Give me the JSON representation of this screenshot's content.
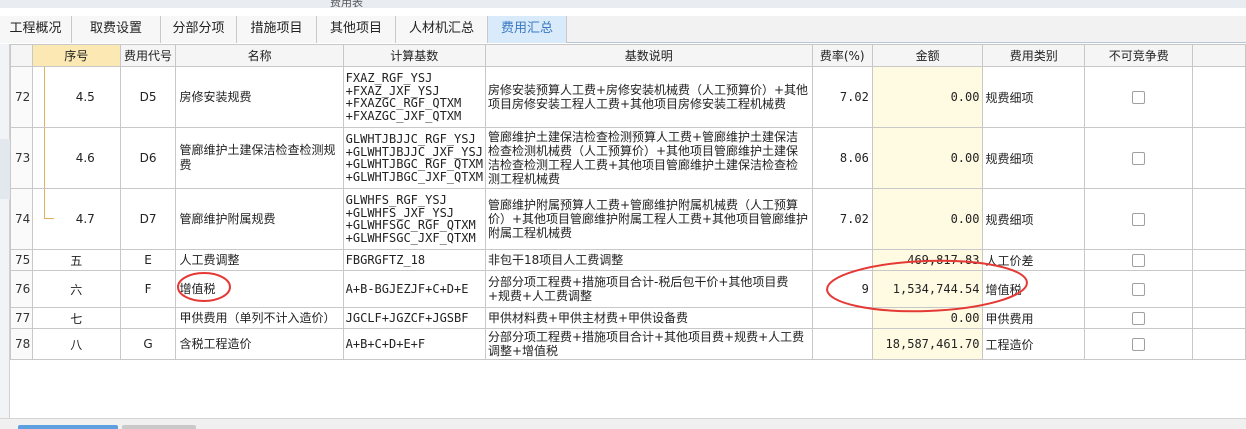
{
  "window_title": "费用表",
  "tabs": [
    {
      "label": "工程概况",
      "active": false
    },
    {
      "label": "取费设置",
      "active": false
    },
    {
      "label": "分部分项",
      "active": false
    },
    {
      "label": "措施项目",
      "active": false
    },
    {
      "label": "其他项目",
      "active": false
    },
    {
      "label": "人材机汇总",
      "active": false
    },
    {
      "label": "费用汇总",
      "active": true
    }
  ],
  "columns": {
    "seq": "序号",
    "code": "费用代号",
    "name": "名称",
    "base": "计算基数",
    "desc": "基数说明",
    "rate": "费率(%)",
    "amount": "金额",
    "category": "费用类别",
    "noncompete": "不可竞争费"
  },
  "rows": [
    {
      "no": "72",
      "seq": "4.5",
      "code": "D5",
      "name": "房修安装规费",
      "base": "FXAZ_RGF_YSJ\n+FXAZ_JXF_YSJ\n+FXAZGC_RGF_QTXM\n+FXAZGC_JXF_QTXM",
      "desc": "房修安装预算人工费+房修安装机械费（人工预算价）+其他项目房修安装工程人工费+其他项目房修安装工程机械费",
      "rate": "7.02",
      "amount": "0.00",
      "category": "规费细项",
      "checked": false
    },
    {
      "no": "73",
      "seq": "4.6",
      "code": "D6",
      "name": "管廊维护土建保洁检查检测规费",
      "base": "GLWHTJBJJC_RGF_YSJ\n+GLWHTJBJJC_JXF_YSJ\n+GLWHTJBGC_RGF_QTXM\n+GLWHTJBGC_JXF_QTXM",
      "desc": "管廊维护土建保洁检查检测预算人工费+管廊维护土建保洁检查检测机械费（人工预算价）+其他项目管廊维护土建保洁检查检测工程人工费+其他项目管廊维护土建保洁检查检测工程机械费",
      "rate": "8.06",
      "amount": "0.00",
      "category": "规费细项",
      "checked": false
    },
    {
      "no": "74",
      "seq": "4.7",
      "code": "D7",
      "name": "管廊维护附属规费",
      "base": "GLWHFS_RGF_YSJ\n+GLWHFS_JXF_YSJ\n+GLWHFSGC_RGF_QTXM\n+GLWHFSGC_JXF_QTXM",
      "desc": "管廊维护附属预算人工费+管廊维护附属机械费（人工预算价）+其他项目管廊维护附属工程人工费+其他项目管廊维护附属工程机械费",
      "rate": "7.02",
      "amount": "0.00",
      "category": "规费细项",
      "checked": false
    },
    {
      "no": "75",
      "seq": "五",
      "code": "E",
      "name": "人工费调整",
      "base": "FBGRGFTZ_18",
      "desc": "非包干18项目人工费调整",
      "rate": "",
      "amount": "469,817.83",
      "category": "人工价差",
      "checked": false
    },
    {
      "no": "76",
      "seq": "六",
      "code": "F",
      "name": "增值税",
      "base": "A+B-BGJEZJF+C+D+E",
      "desc": "分部分项工程费+措施项目合计-税后包干价+其他项目费+规费+人工费调整",
      "rate": "9",
      "amount": "1,534,744.54",
      "category": "增值税",
      "checked": false
    },
    {
      "no": "77",
      "seq": "七",
      "code": "",
      "name": "甲供费用（单列不计入造价）",
      "base": "JGCLF+JGZCF+JGSBF",
      "desc": "甲供材料费+甲供主材费+甲供设备费",
      "rate": "",
      "amount": "0.00",
      "category": "甲供费用",
      "checked": false
    },
    {
      "no": "78",
      "seq": "八",
      "code": "G",
      "name": "含税工程造价",
      "base": "A+B+C+D+E+F",
      "desc": "分部分项工程费+措施项目合计+其他项目费+规费+人工费调整+增值税",
      "rate": "",
      "amount": "18,587,461.70",
      "category": "工程造价",
      "checked": false
    }
  ],
  "annotation_color": "#e53935"
}
